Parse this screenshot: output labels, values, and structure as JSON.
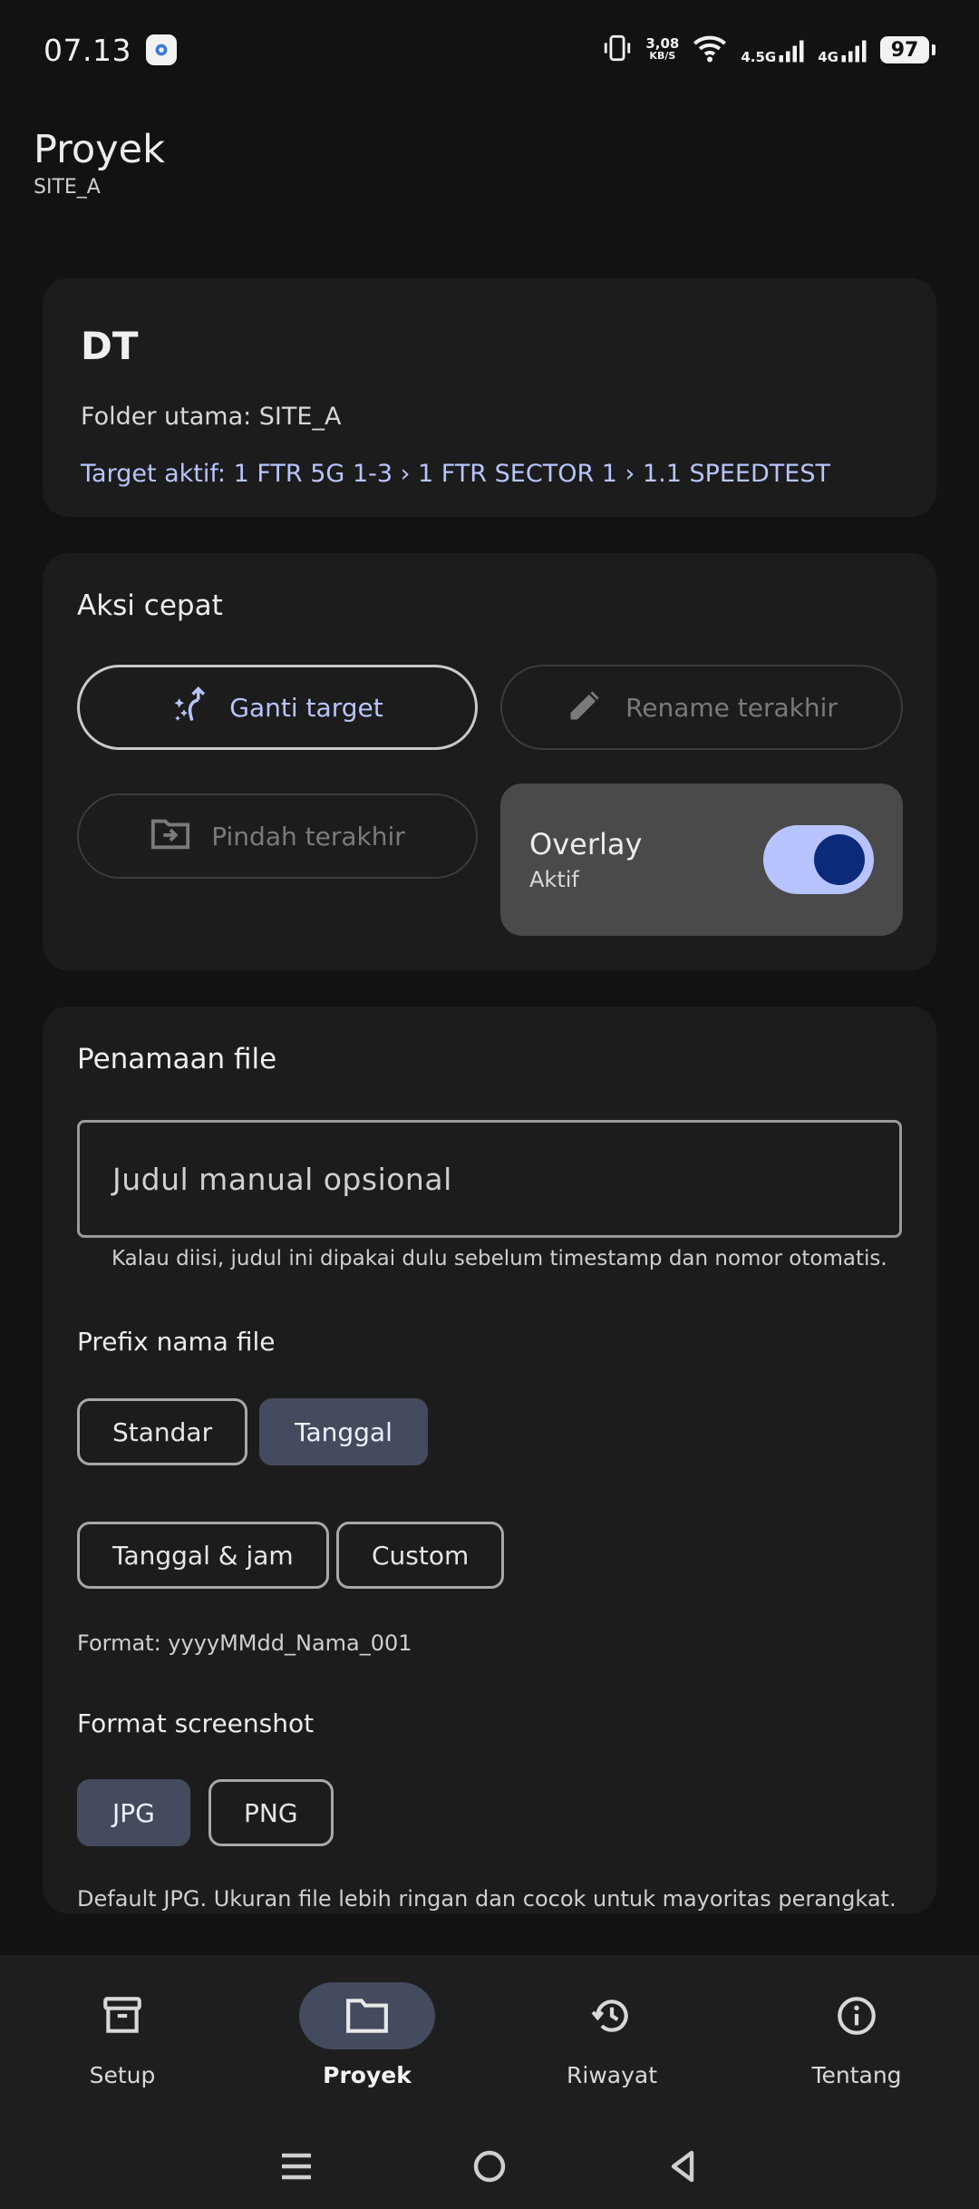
{
  "status_bar": {
    "time": "07.13",
    "net_speed_value": "3,08",
    "net_speed_unit": "KB/S",
    "signal1_label": "4.5G",
    "signal2_label": "4G",
    "battery": "97"
  },
  "header": {
    "title": "Proyek",
    "subtitle": "SITE_A"
  },
  "project_card": {
    "title": "DT",
    "folder": "Folder utama: SITE_A",
    "target": "Target aktif: 1 FTR 5G 1-3 › 1 FTR SECTOR 1 › 1.1 SPEEDTEST"
  },
  "quick_actions": {
    "title": "Aksi cepat",
    "change_target": "Ganti target",
    "rename_last": "Rename terakhir",
    "move_last": "Pindah terakhir",
    "overlay_label": "Overlay",
    "overlay_state": "Aktif",
    "overlay_on": true
  },
  "file_naming": {
    "title": "Penamaan file",
    "manual_title_placeholder": "Judul manual opsional",
    "helper": "Kalau diisi, judul ini dipakai dulu sebelum timestamp dan nomor otomatis.",
    "prefix_title": "Prefix nama file",
    "prefix_options": [
      "Standar",
      "Tanggal",
      "Tanggal & jam",
      "Custom"
    ],
    "prefix_selected": "Tanggal",
    "format_note": "Format: yyyyMMdd_Nama_001",
    "screenshot_title": "Format screenshot",
    "screenshot_options": [
      "JPG",
      "PNG"
    ],
    "screenshot_selected": "JPG",
    "screenshot_note": "Default JPG. Ukuran file lebih ringan dan cocok untuk mayoritas perangkat."
  },
  "bottom_nav": {
    "items": [
      {
        "label": "Setup",
        "icon": "archive-icon"
      },
      {
        "label": "Proyek",
        "icon": "folder-icon"
      },
      {
        "label": "Riwayat",
        "icon": "history-icon"
      },
      {
        "label": "Tentang",
        "icon": "info-icon"
      }
    ],
    "active": "Proyek"
  },
  "colors": {
    "background": "#121212",
    "card": "#1c1c1c",
    "accent": "#b8c4ff",
    "selected_chip": "#454b5e",
    "toggle_knob": "#0b2a7a"
  }
}
